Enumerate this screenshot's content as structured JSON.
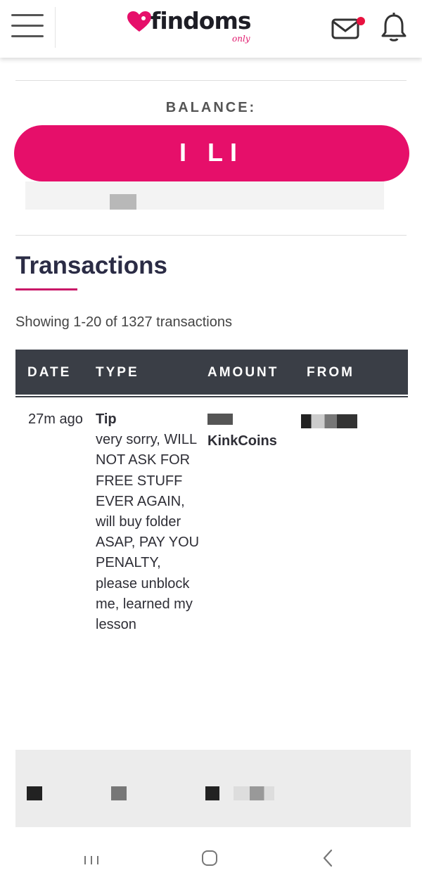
{
  "header": {
    "logo_main": "findoms",
    "logo_sub": "only",
    "brand_color": "#e60f6a",
    "notification_dot_color": "#e8123f"
  },
  "balance": {
    "label": "BALANCE:",
    "value": "I LI",
    "pill_color": "#e60f6a"
  },
  "transactions": {
    "title": "Transactions",
    "count_text": "Showing 1-20 of 1327 transactions",
    "columns": [
      "DATE",
      "TYPE",
      "AMOUNT",
      "FROM"
    ],
    "rows": [
      {
        "date": "27m ago",
        "type": "Tip",
        "message": "very sorry, WILL NOT ASK FOR FREE STUFF EVER AGAIN, will buy folder ASAP, PAY YOU PENALTY, please unblock me, learned my lesson",
        "amount_unit": "KinkCoins"
      }
    ]
  },
  "icons": {
    "menu": "hamburger-menu-icon",
    "mail": "mail-icon",
    "bell": "bell-icon",
    "recents": "android-recents-icon",
    "home": "android-home-icon",
    "back": "android-back-icon"
  }
}
